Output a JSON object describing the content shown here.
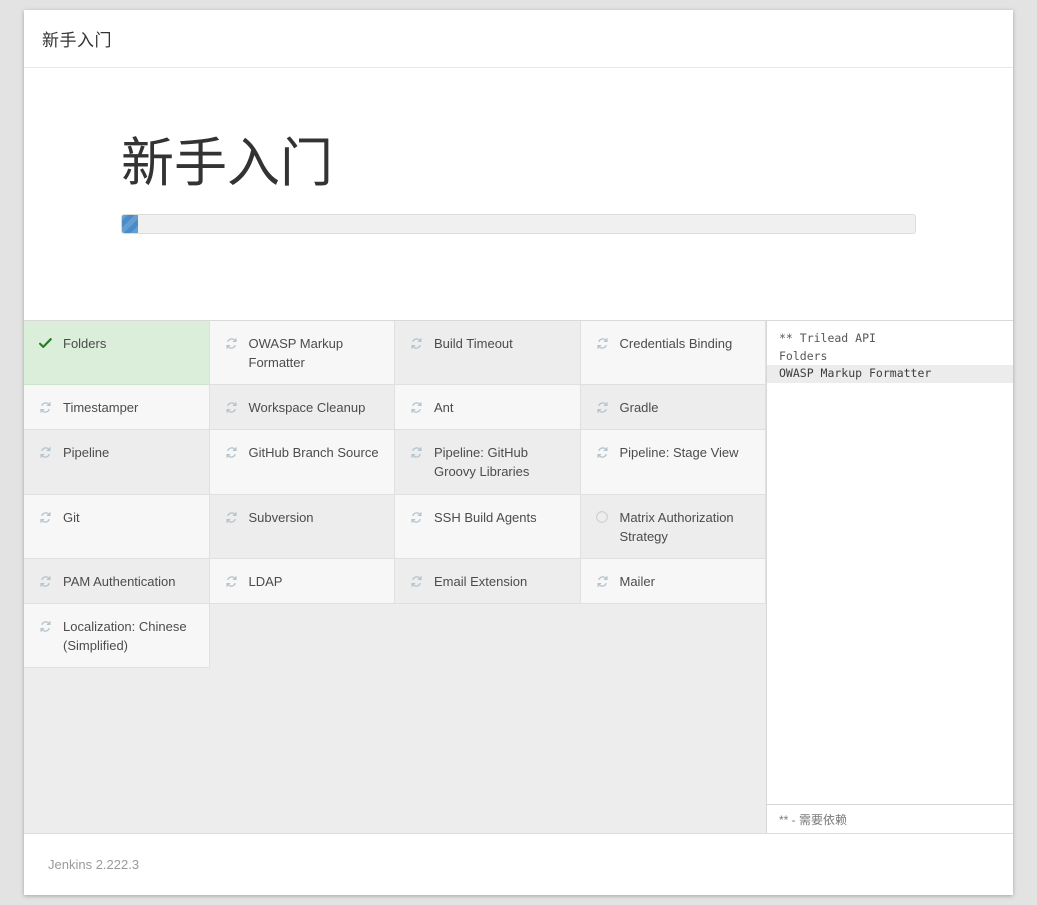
{
  "window": {
    "header_title": "新手入门"
  },
  "banner": {
    "title": "新手入门",
    "progress_percent": 2,
    "progress_color": "#4a8cc7"
  },
  "plugins": {
    "icons": {
      "done": "check-icon",
      "in_progress": "sync-spinner-icon",
      "pending": "empty-circle-icon"
    },
    "items": [
      {
        "label": "Folders",
        "status": "done"
      },
      {
        "label": "OWASP Markup Formatter",
        "status": "in_progress"
      },
      {
        "label": "Build Timeout",
        "status": "in_progress"
      },
      {
        "label": "Credentials Binding",
        "status": "in_progress"
      },
      {
        "label": "Timestamper",
        "status": "in_progress"
      },
      {
        "label": "Workspace Cleanup",
        "status": "in_progress"
      },
      {
        "label": "Ant",
        "status": "in_progress"
      },
      {
        "label": "Gradle",
        "status": "in_progress"
      },
      {
        "label": "Pipeline",
        "status": "in_progress"
      },
      {
        "label": "GitHub Branch Source",
        "status": "in_progress"
      },
      {
        "label": "Pipeline: GitHub Groovy Libraries",
        "status": "in_progress"
      },
      {
        "label": "Pipeline: Stage View",
        "status": "in_progress"
      },
      {
        "label": "Git",
        "status": "in_progress"
      },
      {
        "label": "Subversion",
        "status": "in_progress"
      },
      {
        "label": "SSH Build Agents",
        "status": "in_progress"
      },
      {
        "label": "Matrix Authorization Strategy",
        "status": "pending"
      },
      {
        "label": "PAM Authentication",
        "status": "in_progress"
      },
      {
        "label": "LDAP",
        "status": "in_progress"
      },
      {
        "label": "Email Extension",
        "status": "in_progress"
      },
      {
        "label": "Mailer",
        "status": "in_progress"
      },
      {
        "label": "Localization: Chinese (Simplified)",
        "status": "in_progress"
      }
    ]
  },
  "log": {
    "lines": [
      {
        "text": "** Trilead API",
        "current": false
      },
      {
        "text": "Folders",
        "current": false
      },
      {
        "text": "OWASP Markup Formatter",
        "current": true
      }
    ],
    "footnote": "** - 需要依赖"
  },
  "footer": {
    "version_text": "Jenkins 2.222.3"
  }
}
